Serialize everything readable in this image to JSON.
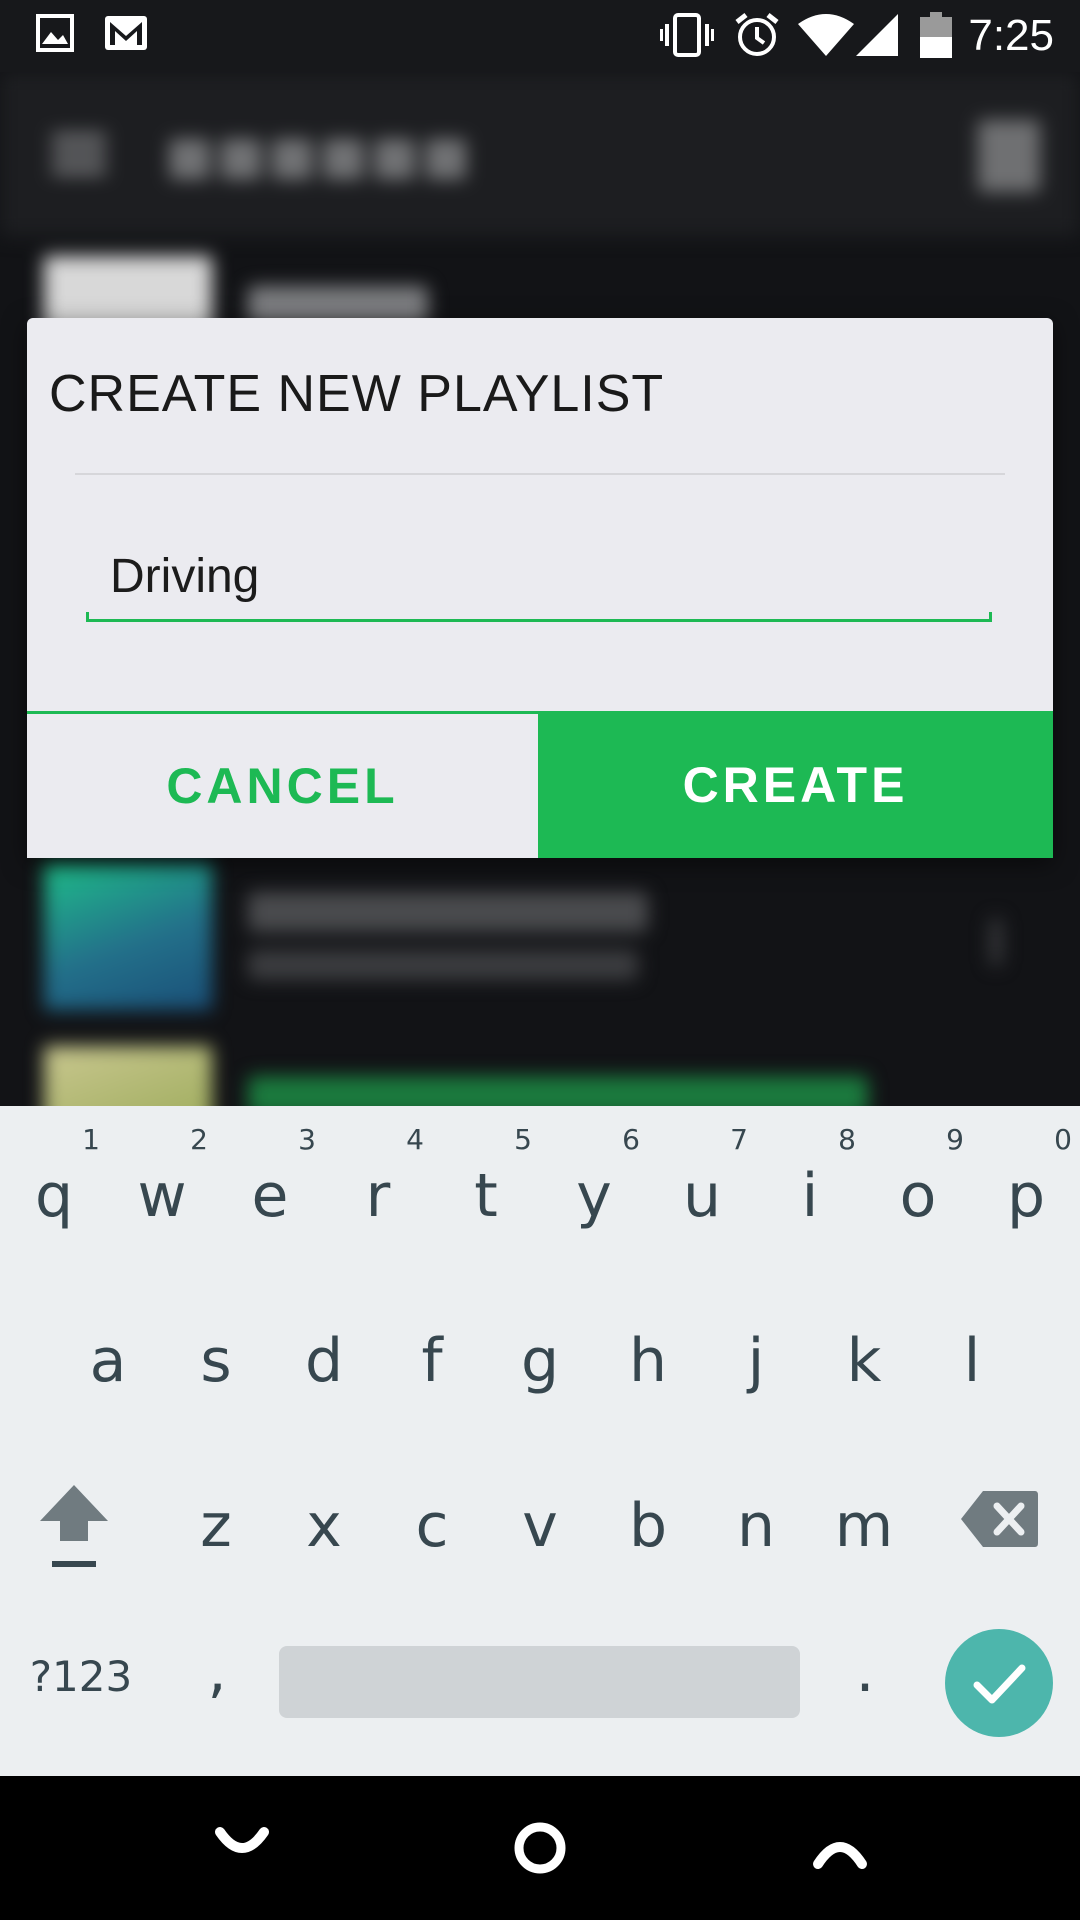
{
  "status_bar": {
    "time": "7:25",
    "left_icons": [
      "image-icon",
      "gmail-icon"
    ],
    "right_icons": [
      "vibrate-icon",
      "alarm-icon",
      "wifi-icon",
      "cell-signal-icon",
      "battery-icon"
    ]
  },
  "dialog": {
    "title": "CREATE NEW PLAYLIST",
    "input_value": "Driving",
    "cancel_label": "CANCEL",
    "create_label": "CREATE"
  },
  "keyboard": {
    "row1": [
      {
        "key": "q",
        "hint": "1"
      },
      {
        "key": "w",
        "hint": "2"
      },
      {
        "key": "e",
        "hint": "3"
      },
      {
        "key": "r",
        "hint": "4"
      },
      {
        "key": "t",
        "hint": "5"
      },
      {
        "key": "y",
        "hint": "6"
      },
      {
        "key": "u",
        "hint": "7"
      },
      {
        "key": "i",
        "hint": "8"
      },
      {
        "key": "o",
        "hint": "9"
      },
      {
        "key": "p",
        "hint": "0"
      }
    ],
    "row2": [
      "a",
      "s",
      "d",
      "f",
      "g",
      "h",
      "j",
      "k",
      "l"
    ],
    "row3": [
      "z",
      "x",
      "c",
      "v",
      "b",
      "n",
      "m"
    ],
    "symbols_label": "?123",
    "comma": ",",
    "period": ".",
    "shift_icon": "shift-icon",
    "backspace_icon": "backspace-icon",
    "enter_icon": "checkmark-icon"
  },
  "nav_bar": {
    "icons": [
      "back-icon",
      "home-icon",
      "recents-icon"
    ]
  },
  "colors": {
    "accent": "#1db954",
    "keyboard_bg": "#eceff1",
    "enter_key": "#4db6ac",
    "dialog_bg": "#ebebf0"
  }
}
